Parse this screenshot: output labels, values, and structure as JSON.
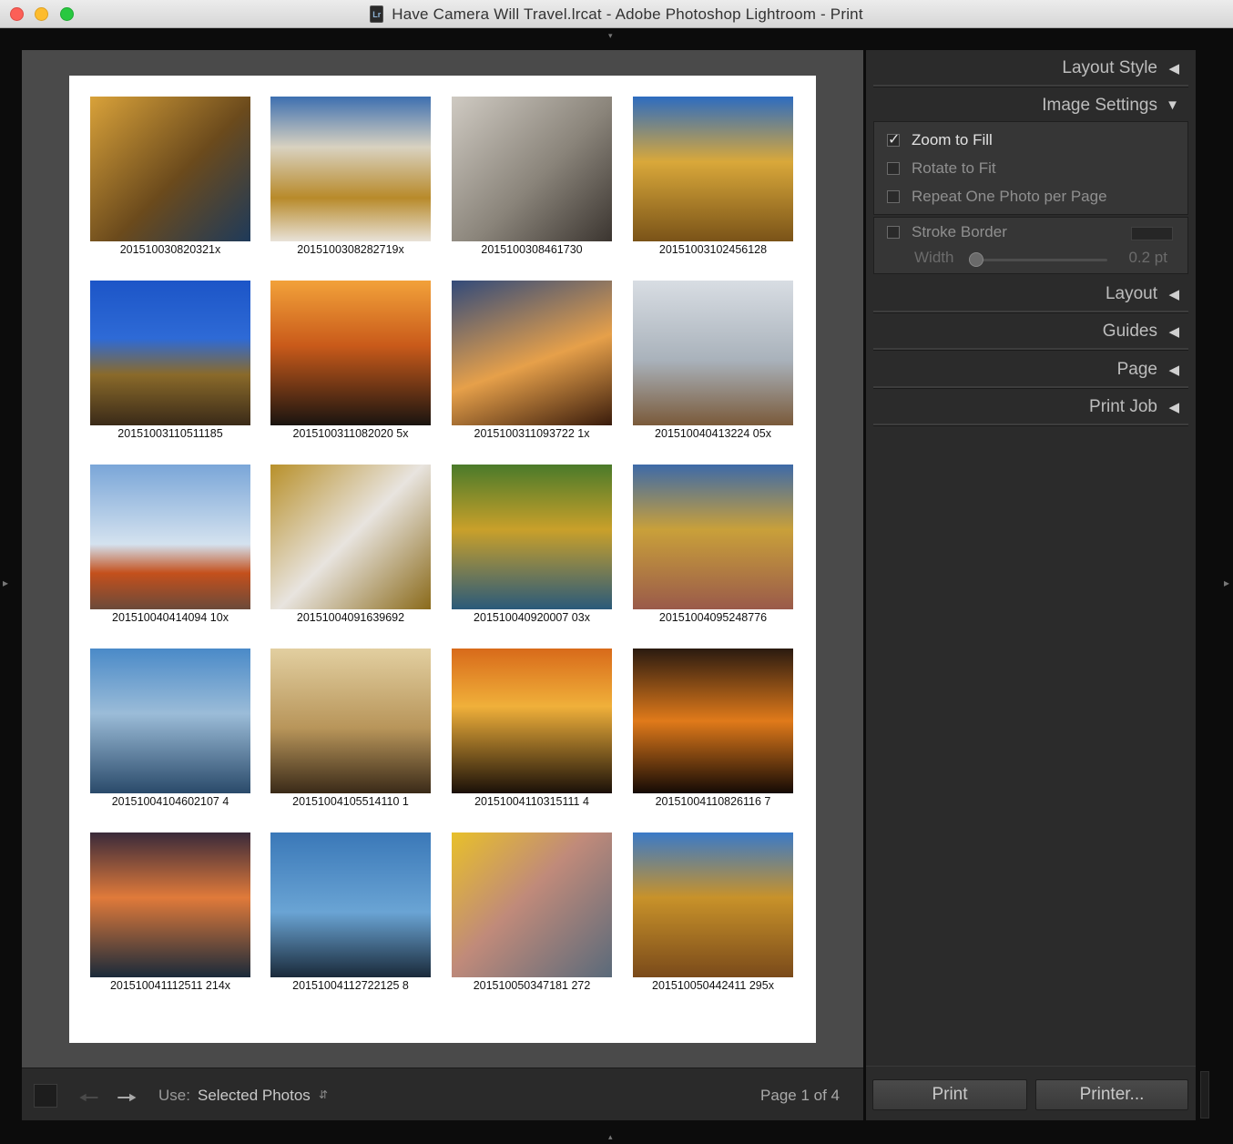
{
  "window": {
    "title": "Have Camera Will Travel.lrcat - Adobe Photoshop Lightroom - Print",
    "doc_icon_text": "Lr"
  },
  "grid": {
    "captions": [
      "201510030820321x",
      "2015100308282719x",
      "2015100308461730",
      "20151003102456128",
      "20151003110511185",
      "2015100311082020 5x",
      "2015100311093722 1x",
      "201510040413224 05x",
      "201510040414094 10x",
      "20151004091639692",
      "201510040920007 03x",
      "20151004095248776",
      "20151004104602107 4",
      "20151004105514110 1",
      "20151004110315111 4",
      "20151004110826116 7",
      "201510041112511 214x",
      "20151004112722125 8",
      "201510050347181 272",
      "201510050442411 295x"
    ]
  },
  "toolbar": {
    "use_label": "Use:",
    "use_value": "Selected Photos",
    "select_arrow": "⬍",
    "page_indicator": "Page 1 of 4",
    "back_icon": "arrow-left-icon",
    "forward_icon": "arrow-right-icon"
  },
  "panel": {
    "sections": {
      "layout_style": "Layout Style",
      "image_settings": "Image Settings",
      "layout": "Layout",
      "guides": "Guides",
      "page": "Page",
      "print_job": "Print Job"
    },
    "collapsed_arrow": "◀",
    "expanded_arrow": "▼",
    "image_settings": {
      "zoom_to_fill": "Zoom to Fill",
      "zoom_to_fill_checked": true,
      "rotate_to_fit": "Rotate to Fit",
      "rotate_to_fit_checked": false,
      "repeat_one": "Repeat One Photo per Page",
      "repeat_one_checked": false,
      "stroke_border": "Stroke Border",
      "stroke_border_checked": false,
      "width_label": "Width",
      "width_value": "0.2 pt"
    },
    "buttons": {
      "print": "Print",
      "printer": "Printer..."
    }
  },
  "colors": {
    "workspace": "#4a4a4a",
    "panel": "#2b2b2b",
    "page": "#ffffff"
  }
}
